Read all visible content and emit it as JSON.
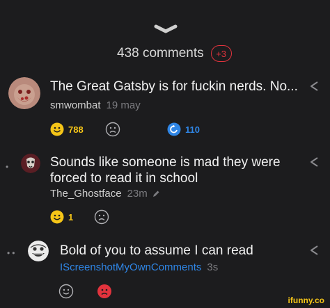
{
  "header": {
    "comments_label": "438 comments",
    "new_badge": "+3"
  },
  "comments": [
    {
      "text": "The Great Gatsby is for fuckin nerds. No...",
      "username": "smwombat",
      "time": "19 may",
      "smile_count": "788",
      "repub_count": "110"
    },
    {
      "text_line1": "Sounds like someone is mad they were",
      "text_line2": "forced to read it in school",
      "username": "The_Ghostface",
      "time": "23m",
      "smile_count": "1"
    },
    {
      "text": "Bold of you to assume I can read",
      "username": "IScreenshotMyOwnComments",
      "time": "3s"
    }
  ],
  "watermark": "ifunny.co",
  "colors": {
    "background": "#1c1c1e",
    "accent_yellow": "#f5c518",
    "accent_blue": "#2f86e6",
    "accent_red": "#e2333d"
  }
}
